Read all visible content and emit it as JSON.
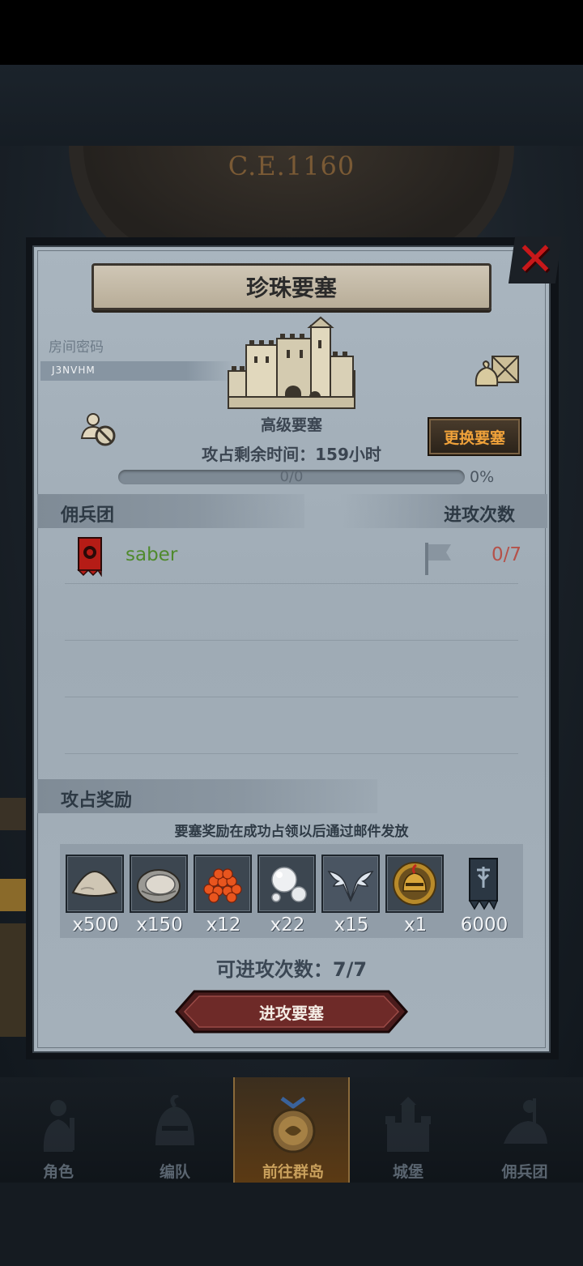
{
  "background": {
    "era": "C.E.1160"
  },
  "dialog": {
    "title": "珍珠要塞",
    "close_icon": "close-icon",
    "room": {
      "label": "房间密码",
      "code": "J3NVHM"
    },
    "fortress": {
      "level": "高级要塞",
      "time_remaining": "攻占剩余时间：159小时"
    },
    "change_button": "更换要塞",
    "progress": {
      "text": "0/0",
      "percent_label": "0%",
      "fraction": 0
    },
    "guild_section": {
      "title": "佣兵团",
      "attack_header": "进攻次数",
      "rows": [
        {
          "name": "saber",
          "attacks": "0/7"
        }
      ]
    },
    "rewards": {
      "title": "攻占奖励",
      "note": "要塞奖励在成功占领以后通过邮件发放",
      "items": [
        {
          "icon": "sand-pile-icon",
          "count": "x500"
        },
        {
          "icon": "oyster-icon",
          "count": "x150"
        },
        {
          "icon": "fish-roe-icon",
          "count": "x12"
        },
        {
          "icon": "pearl-icon",
          "count": "x22"
        },
        {
          "icon": "winged-emblem-icon",
          "count": "x15"
        },
        {
          "icon": "golden-helmet-icon",
          "count": "x1"
        },
        {
          "icon": "guild-banner-icon",
          "count": "6000"
        }
      ]
    },
    "attacks_available": "可进攻次数：7/7",
    "attack_button": "进攻要塞"
  },
  "nav": {
    "items": [
      {
        "label": "角色",
        "icon": "knight-icon"
      },
      {
        "label": "编队",
        "icon": "helmet-icon"
      },
      {
        "label": "前往群岛",
        "icon": "compass-icon"
      },
      {
        "label": "城堡",
        "icon": "castle-icon"
      },
      {
        "label": "佣兵团",
        "icon": "rider-icon"
      }
    ],
    "active_index": 2
  },
  "colors": {
    "accent_orange": "#f0a23a",
    "danger_red": "#c8181a",
    "guild_green": "#4f8a2c",
    "count_red": "#b55149"
  }
}
